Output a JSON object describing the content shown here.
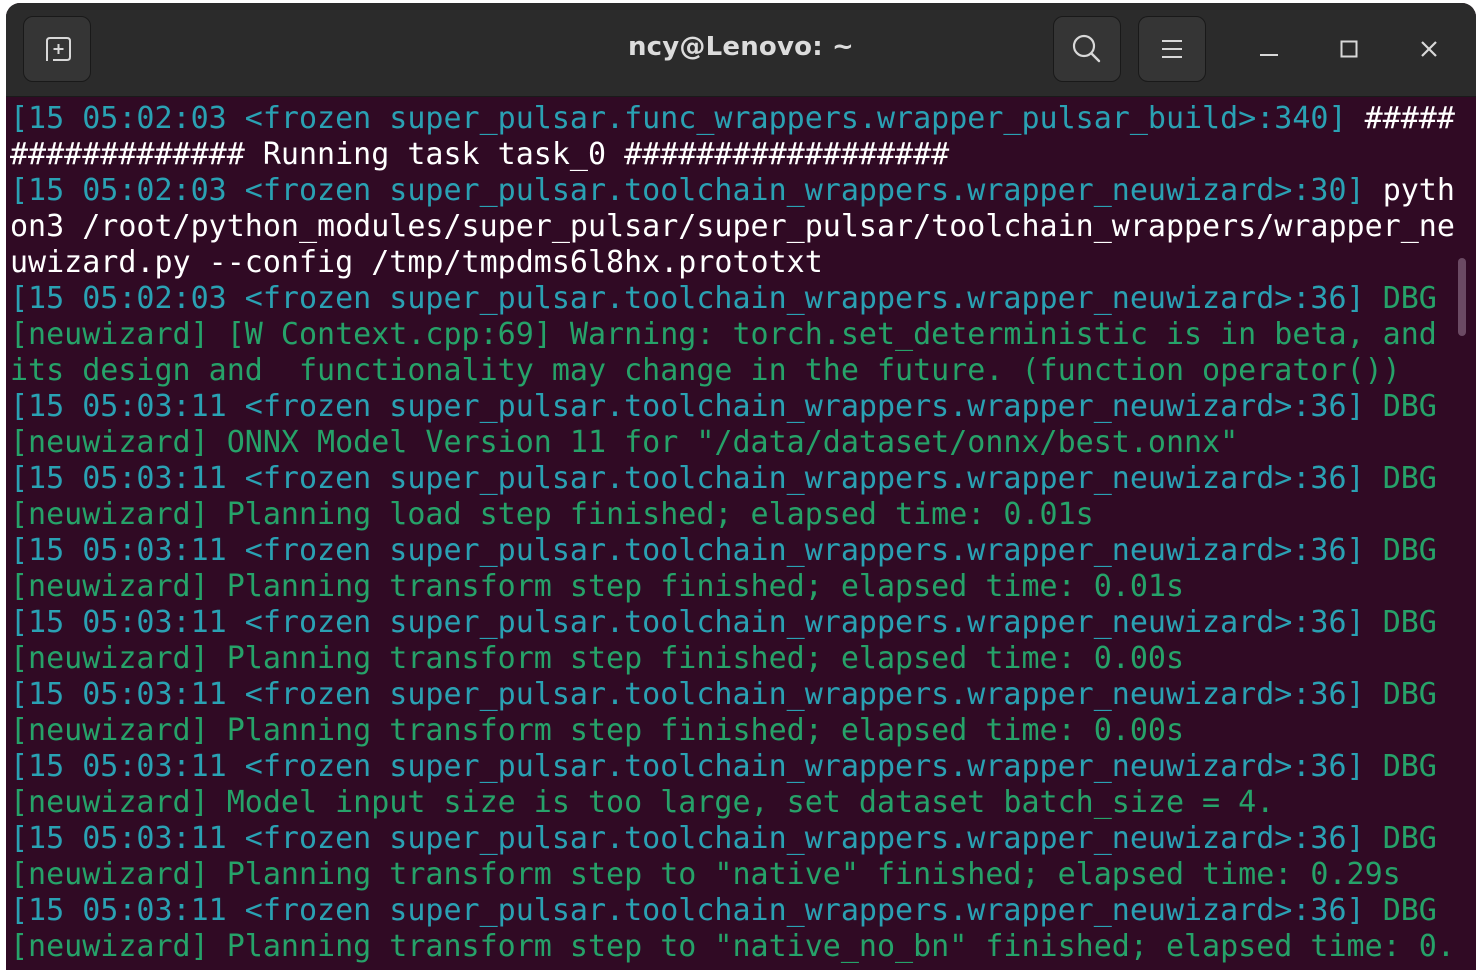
{
  "window": {
    "title": "ncy@Lenovo: ~",
    "colors": {
      "background": "#300a24",
      "titlebar": "#2b2b2b",
      "timestamp_cyan": "#2aa1b3",
      "debug_green": "#26a269",
      "text_white": "#ffffff"
    }
  },
  "titlebar": {
    "new_tab_icon": "new-tab-icon",
    "search_icon": "search-icon",
    "menu_icon": "hamburger-menu-icon",
    "minimize_icon": "minimize-icon",
    "maximize_icon": "maximize-icon",
    "close_icon": "close-icon"
  },
  "terminal": {
    "lines": [
      [
        {
          "t": "[15 05:02:03 <frozen super_pulsar.func_wrappers.wrapper_pulsar_build>:340] ",
          "c": "cyan"
        },
        {
          "t": "#####",
          "c": "white"
        }
      ],
      [
        {
          "t": "############# Running task task_0 ##################",
          "c": "white"
        }
      ],
      [
        {
          "t": "[15 05:02:03 <frozen super_pulsar.toolchain_wrappers.wrapper_neuwizard>:30] ",
          "c": "cyan"
        },
        {
          "t": "pyth",
          "c": "white"
        }
      ],
      [
        {
          "t": "on3 /root/python_modules/super_pulsar/super_pulsar/toolchain_wrappers/wrapper_ne",
          "c": "white"
        }
      ],
      [
        {
          "t": "uwizard.py --config /tmp/tmpdms6l8hx.prototxt",
          "c": "white"
        }
      ],
      [
        {
          "t": "[15 05:02:03 <frozen super_pulsar.toolchain_wrappers.wrapper_neuwizard>:36] ",
          "c": "cyan"
        },
        {
          "t": "DBG",
          "c": "green"
        }
      ],
      [
        {
          "t": "[neuwizard] [W Context.cpp:69] Warning: torch.set_deterministic is in beta, and",
          "c": "green"
        }
      ],
      [
        {
          "t": "its design and  functionality may change in the future. (function operator())",
          "c": "green"
        }
      ],
      [
        {
          "t": "[15 05:03:11 <frozen super_pulsar.toolchain_wrappers.wrapper_neuwizard>:36] ",
          "c": "cyan"
        },
        {
          "t": "DBG",
          "c": "green"
        }
      ],
      [
        {
          "t": "[neuwizard] ONNX Model Version 11 for \"/data/dataset/onnx/best.onnx\"",
          "c": "green"
        }
      ],
      [
        {
          "t": "[15 05:03:11 <frozen super_pulsar.toolchain_wrappers.wrapper_neuwizard>:36] ",
          "c": "cyan"
        },
        {
          "t": "DBG",
          "c": "green"
        }
      ],
      [
        {
          "t": "[neuwizard] Planning load step finished; elapsed time: 0.01s",
          "c": "green"
        }
      ],
      [
        {
          "t": "[15 05:03:11 <frozen super_pulsar.toolchain_wrappers.wrapper_neuwizard>:36] ",
          "c": "cyan"
        },
        {
          "t": "DBG",
          "c": "green"
        }
      ],
      [
        {
          "t": "[neuwizard] Planning transform step finished; elapsed time: 0.01s",
          "c": "green"
        }
      ],
      [
        {
          "t": "[15 05:03:11 <frozen super_pulsar.toolchain_wrappers.wrapper_neuwizard>:36] ",
          "c": "cyan"
        },
        {
          "t": "DBG",
          "c": "green"
        }
      ],
      [
        {
          "t": "[neuwizard] Planning transform step finished; elapsed time: 0.00s",
          "c": "green"
        }
      ],
      [
        {
          "t": "[15 05:03:11 <frozen super_pulsar.toolchain_wrappers.wrapper_neuwizard>:36] ",
          "c": "cyan"
        },
        {
          "t": "DBG",
          "c": "green"
        }
      ],
      [
        {
          "t": "[neuwizard] Planning transform step finished; elapsed time: 0.00s",
          "c": "green"
        }
      ],
      [
        {
          "t": "[15 05:03:11 <frozen super_pulsar.toolchain_wrappers.wrapper_neuwizard>:36] ",
          "c": "cyan"
        },
        {
          "t": "DBG",
          "c": "green"
        }
      ],
      [
        {
          "t": "[neuwizard] Model input size is too large, set dataset batch_size = 4.",
          "c": "green"
        }
      ],
      [
        {
          "t": "[15 05:03:11 <frozen super_pulsar.toolchain_wrappers.wrapper_neuwizard>:36] ",
          "c": "cyan"
        },
        {
          "t": "DBG",
          "c": "green"
        }
      ],
      [
        {
          "t": "[neuwizard] Planning transform step to \"native\" finished; elapsed time: 0.29s",
          "c": "green"
        }
      ],
      [
        {
          "t": "[15 05:03:11 <frozen super_pulsar.toolchain_wrappers.wrapper_neuwizard>:36] ",
          "c": "cyan"
        },
        {
          "t": "DBG",
          "c": "green"
        }
      ],
      [
        {
          "t": "[neuwizard] Planning transform step to \"native_no_bn\" finished; elapsed time: 0.",
          "c": "green"
        }
      ]
    ]
  }
}
